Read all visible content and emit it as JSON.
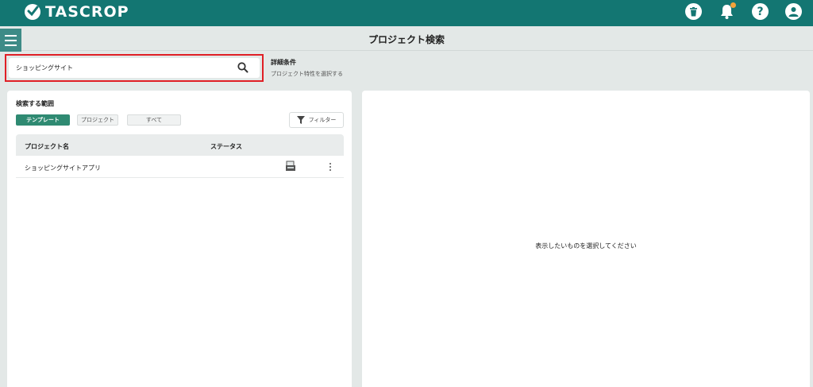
{
  "app": {
    "brand": "TASCROP",
    "title": "プロジェクト検索"
  },
  "header_icons": [
    "trash-icon",
    "bell-icon",
    "help-icon",
    "user-icon"
  ],
  "search": {
    "value": "ショッピングサイト"
  },
  "detail": {
    "title": "詳細条件",
    "subtitle": "プロジェクト特性を選択する"
  },
  "scope": {
    "label": "検索する範囲",
    "chips": [
      "テンプレート",
      "プロジェクト",
      "すべて"
    ],
    "filter_label": "フィルター"
  },
  "table": {
    "headers": [
      "プロジェクト名",
      "ステータス"
    ],
    "rows": [
      {
        "name": "ショッピングサイトアプリ"
      }
    ]
  },
  "right_panel": {
    "placeholder": "表示したいものを選択してください"
  },
  "colors": {
    "brand": "#137672",
    "accent": "#2f8a72",
    "highlight": "#e01f26"
  }
}
